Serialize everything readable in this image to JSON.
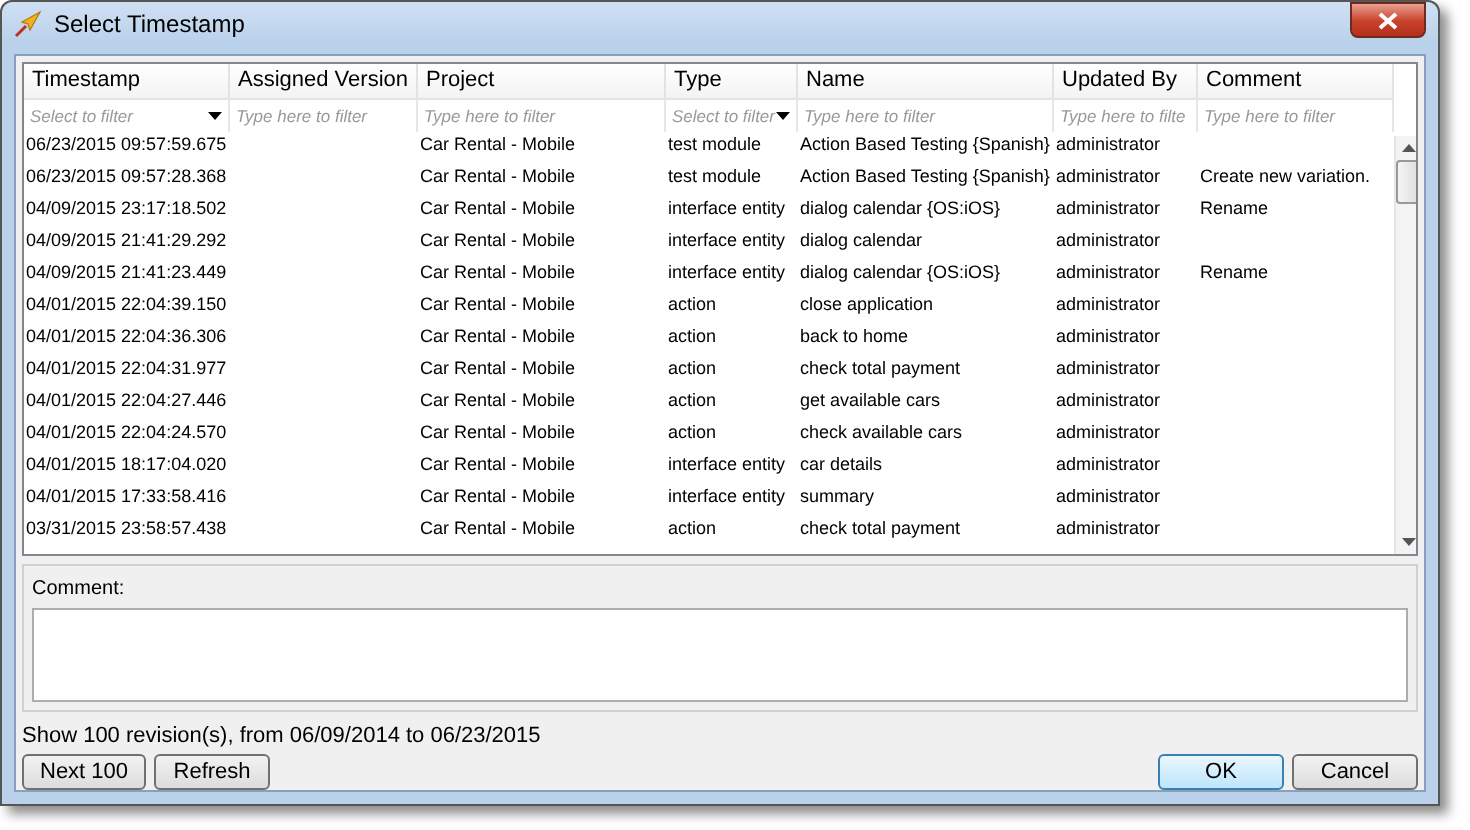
{
  "window": {
    "title": "Select Timestamp"
  },
  "table": {
    "columns": [
      {
        "label": "Timestamp",
        "filter": {
          "kind": "select",
          "placeholder": "Select to filter"
        }
      },
      {
        "label": "Assigned Version",
        "filter": {
          "kind": "text",
          "placeholder": "Type here to filter"
        }
      },
      {
        "label": "Project",
        "filter": {
          "kind": "text",
          "placeholder": "Type here to filter"
        }
      },
      {
        "label": "Type",
        "filter": {
          "kind": "select",
          "placeholder": "Select to filter"
        }
      },
      {
        "label": "Name",
        "filter": {
          "kind": "text",
          "placeholder": "Type here to filter"
        }
      },
      {
        "label": "Updated By",
        "filter": {
          "kind": "text",
          "placeholder": "Type here to filte"
        }
      },
      {
        "label": "Comment",
        "filter": {
          "kind": "text",
          "placeholder": "Type here to filter"
        }
      }
    ],
    "rows": [
      {
        "timestamp": "06/23/2015 09:57:59.675",
        "project": "Car Rental - Mobile",
        "type": "test module",
        "name": "Action Based Testing {Spanish}",
        "updated_by": "administrator"
      },
      {
        "timestamp": "06/23/2015 09:57:28.368",
        "project": "Car Rental - Mobile",
        "type": "test module",
        "name": "Action Based Testing {Spanish}",
        "updated_by": "administrator",
        "comment": "Create new variation."
      },
      {
        "timestamp": "04/09/2015 23:17:18.502",
        "project": "Car Rental - Mobile",
        "type": "interface entity",
        "name": "dialog calendar {OS:iOS}",
        "updated_by": "administrator",
        "comment": "Rename"
      },
      {
        "timestamp": "04/09/2015 21:41:29.292",
        "project": "Car Rental - Mobile",
        "type": "interface entity",
        "name": "dialog calendar",
        "updated_by": "administrator"
      },
      {
        "timestamp": "04/09/2015 21:41:23.449",
        "project": "Car Rental - Mobile",
        "type": "interface entity",
        "name": "dialog calendar {OS:iOS}",
        "updated_by": "administrator",
        "comment": "Rename"
      },
      {
        "timestamp": "04/01/2015 22:04:39.150",
        "project": "Car Rental - Mobile",
        "type": "action",
        "name": "close application",
        "updated_by": "administrator"
      },
      {
        "timestamp": "04/01/2015 22:04:36.306",
        "project": "Car Rental - Mobile",
        "type": "action",
        "name": "back to home",
        "updated_by": "administrator"
      },
      {
        "timestamp": "04/01/2015 22:04:31.977",
        "project": "Car Rental - Mobile",
        "type": "action",
        "name": "check total payment",
        "updated_by": "administrator"
      },
      {
        "timestamp": "04/01/2015 22:04:27.446",
        "project": "Car Rental - Mobile",
        "type": "action",
        "name": "get available cars",
        "updated_by": "administrator"
      },
      {
        "timestamp": "04/01/2015 22:04:24.570",
        "project": "Car Rental - Mobile",
        "type": "action",
        "name": "check available cars",
        "updated_by": "administrator"
      },
      {
        "timestamp": "04/01/2015 18:17:04.020",
        "project": "Car Rental - Mobile",
        "type": "interface entity",
        "name": "car details",
        "updated_by": "administrator"
      },
      {
        "timestamp": "04/01/2015 17:33:58.416",
        "project": "Car Rental - Mobile",
        "type": "interface entity",
        "name": "summary",
        "updated_by": "administrator"
      },
      {
        "timestamp": "03/31/2015 23:58:57.438",
        "project": "Car Rental - Mobile",
        "type": "action",
        "name": "check total payment",
        "updated_by": "administrator"
      }
    ]
  },
  "comment": {
    "label": "Comment:"
  },
  "status": "Show 100 revision(s), from 06/09/2014 to 06/23/2015",
  "left_buttons": [
    {
      "label": "Next 100",
      "default": false
    },
    {
      "label": "Refresh",
      "default": false
    }
  ],
  "right_buttons": [
    {
      "label": "OK",
      "default": true
    },
    {
      "label": "Cancel",
      "default": false
    }
  ]
}
